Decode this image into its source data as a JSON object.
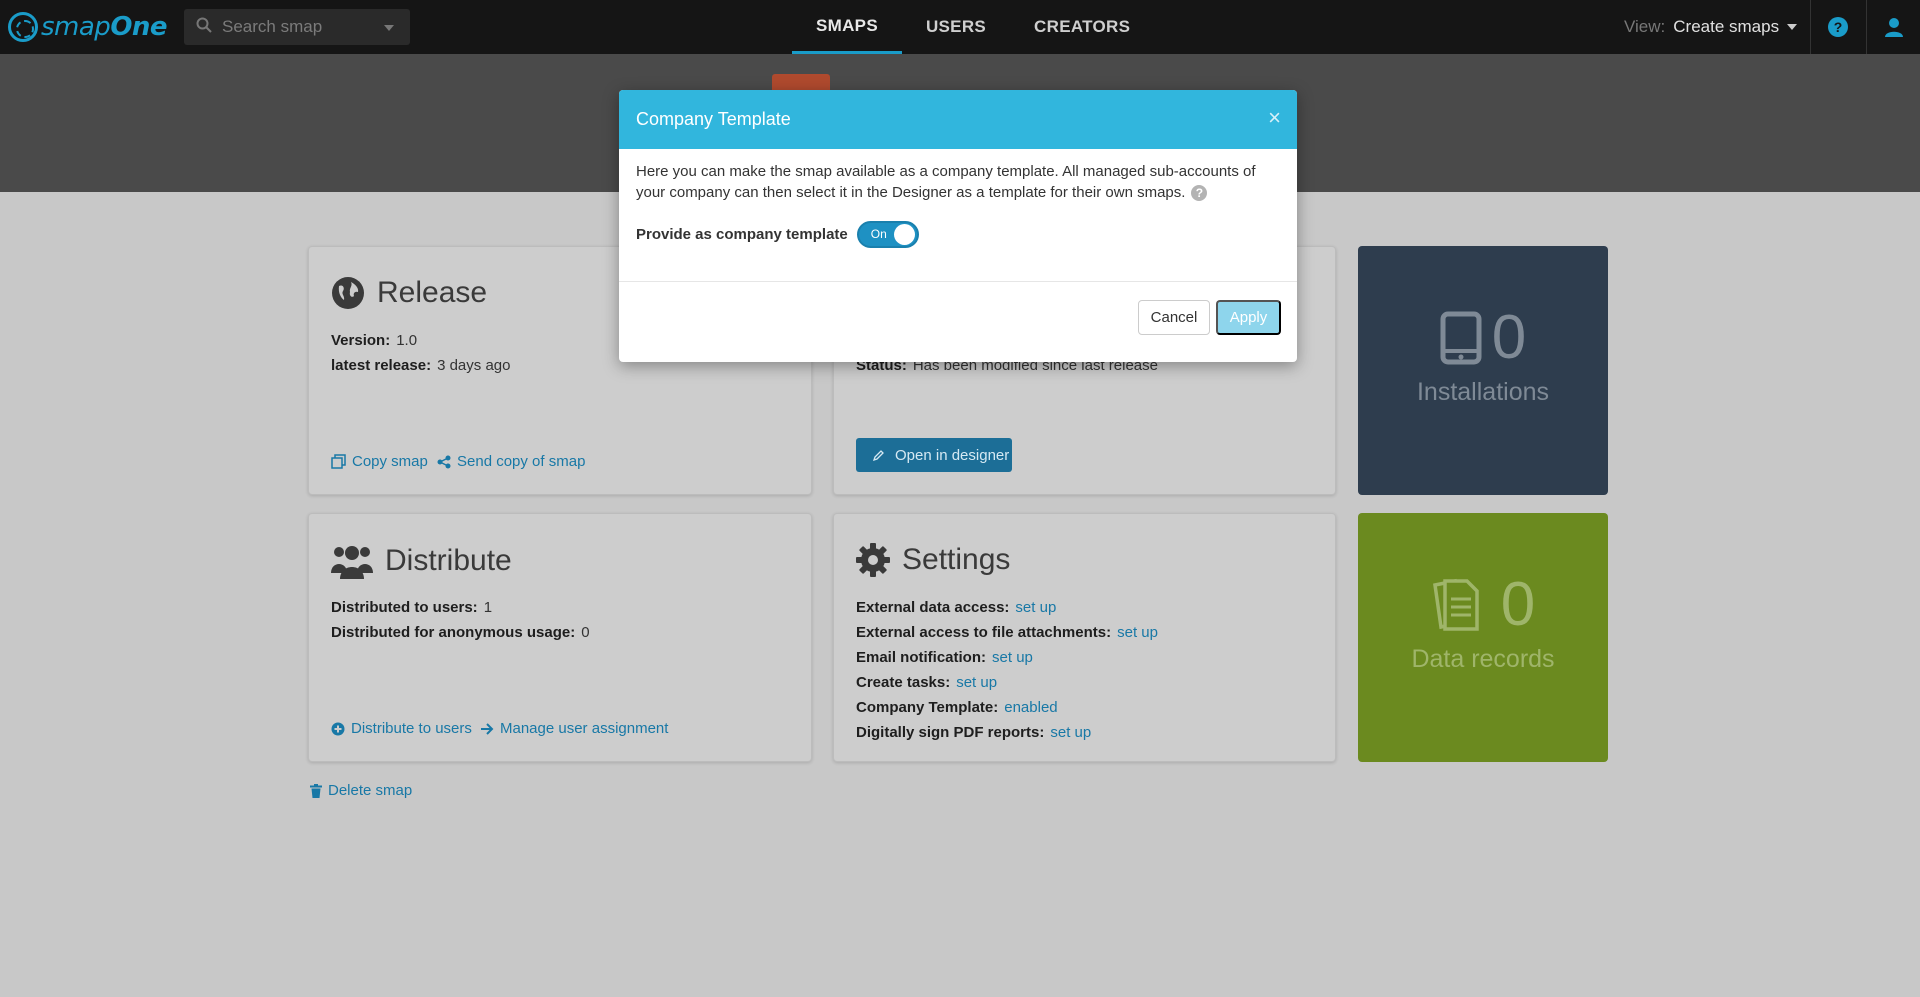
{
  "navbar": {
    "logo_text_light": "smap",
    "logo_text_bold": "One",
    "search_placeholder": "Search smap",
    "tabs": [
      {
        "label": "SMAPS",
        "active": true
      },
      {
        "label": "USERS",
        "active": false
      },
      {
        "label": "CREATORS",
        "active": false
      }
    ],
    "view_label": "View:",
    "view_value": "Create smaps",
    "help_icon": "help-icon",
    "user_icon": "user-icon"
  },
  "release": {
    "title": "Release",
    "version_key": "Version:",
    "version_value": "1.0",
    "latest_key": "latest release:",
    "latest_value": "3 days ago",
    "copy_link": "Copy smap",
    "send_link": "Send copy of smap"
  },
  "edit": {
    "status_key": "Status:",
    "status_value": "Has been modified since last release",
    "designer_button": "Open in designer"
  },
  "installations": {
    "count": "0",
    "label": "Installations",
    "color": "#2e3d4e"
  },
  "distribute": {
    "title": "Distribute",
    "users_key": "Distributed to users:",
    "users_value": "1",
    "anon_key": "Distributed for anonymous usage:",
    "anon_value": "0",
    "distribute_link": "Distribute to users",
    "manage_link": "Manage user assignment"
  },
  "settings": {
    "title": "Settings",
    "rows": [
      {
        "key": "External data access:",
        "value": "set up"
      },
      {
        "key": "External access to file attachments:",
        "value": "set up"
      },
      {
        "key": "Email notification:",
        "value": "set up"
      },
      {
        "key": "Create tasks:",
        "value": "set up"
      },
      {
        "key": "Company Template:",
        "value": "enabled"
      },
      {
        "key": "Digitally sign PDF reports:",
        "value": "set up"
      }
    ]
  },
  "data_records": {
    "count": "0",
    "label": "Data records",
    "color": "#6b8a1f"
  },
  "delete_link": "Delete smap",
  "modal": {
    "title": "Company Template",
    "close": "×",
    "description": "Here you can make the smap available as a company template. All managed sub-accounts of your company can then select it in the Designer as a template for their own smaps.",
    "help": "?",
    "toggle_label": "Provide as company template",
    "toggle_state": "On",
    "cancel": "Cancel",
    "apply": "Apply"
  },
  "colors": {
    "accent": "#31b6dd",
    "link": "#1878a6",
    "navbar": "#151515"
  }
}
